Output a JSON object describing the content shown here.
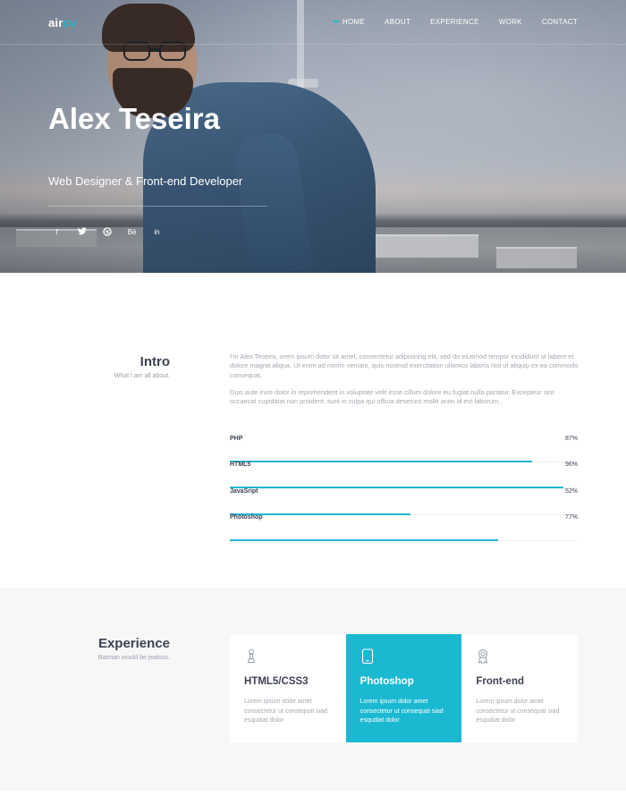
{
  "brand": {
    "logo_part1": "air",
    "logo_part2": "cv",
    "accent_color": "#23b6cf"
  },
  "nav": {
    "items": [
      {
        "label": "HOME",
        "active": true
      },
      {
        "label": "ABOUT",
        "active": false
      },
      {
        "label": "EXPERIENCE",
        "active": false
      },
      {
        "label": "WORK",
        "active": false
      },
      {
        "label": "CONTACT",
        "active": false
      }
    ]
  },
  "hero": {
    "name": "Alex Teseira",
    "role": "Web Designer & Front-end Developer",
    "social_icons": [
      {
        "icon": "facebook-icon",
        "glyph": "f"
      },
      {
        "icon": "twitter-icon",
        "glyph": "t"
      },
      {
        "icon": "dribbble-icon",
        "glyph": "◎"
      },
      {
        "icon": "behance-icon",
        "glyph": "Bē"
      },
      {
        "icon": "linkedin-icon",
        "glyph": "in"
      }
    ]
  },
  "intro": {
    "title": "Intro",
    "subtitle": "What I am all about.",
    "paragraph1": "I'm Alex Teseira, orem ipsum dolor sit amet, consectetur adipisicing elit, sed do eiusmod tempor incididunt ut labore et dolore magna aliqua. Ut enim ad minim veniam, quis nostrud exercitation ullamco laboris nisi ut aliquip ex ea commodo consequat.",
    "paragraph2": "Duis aute irure dolor in reprehenderit in voluptate velit esse cillum dolore eu fugiat nulla pariatur. Excepteur sint occaecat cupidatat non proident, sunt in culpa qui officia deserunt mollit anim id est laborum.",
    "skills": [
      {
        "name": "PHP",
        "percent_label": "87%",
        "value": 87
      },
      {
        "name": "HTML5",
        "percent_label": "96%",
        "value": 96
      },
      {
        "name": "JavaSript",
        "percent_label": "52%",
        "value": 52
      },
      {
        "name": "Photoshop",
        "percent_label": "77%",
        "value": 77
      }
    ]
  },
  "experience": {
    "title": "Experience",
    "subtitle": "Batman would be jealous.",
    "cards": [
      {
        "icon": "chess-pawn-icon",
        "title": "HTML5/CSS3",
        "text": "Lorem ipsum dolor amet consectetur ut consequat siad esqudiat dolor",
        "active": false
      },
      {
        "icon": "tablet-icon",
        "title": "Photoshop",
        "text": "Lorem ipsum dolor amet consectetur ut consequat siad esqudiat dolor",
        "active": true
      },
      {
        "icon": "award-icon",
        "title": "Front-end",
        "text": "Lorem ipsum dolor amet consectetur ut consequat siad esqudiat dolor",
        "active": false
      }
    ]
  }
}
